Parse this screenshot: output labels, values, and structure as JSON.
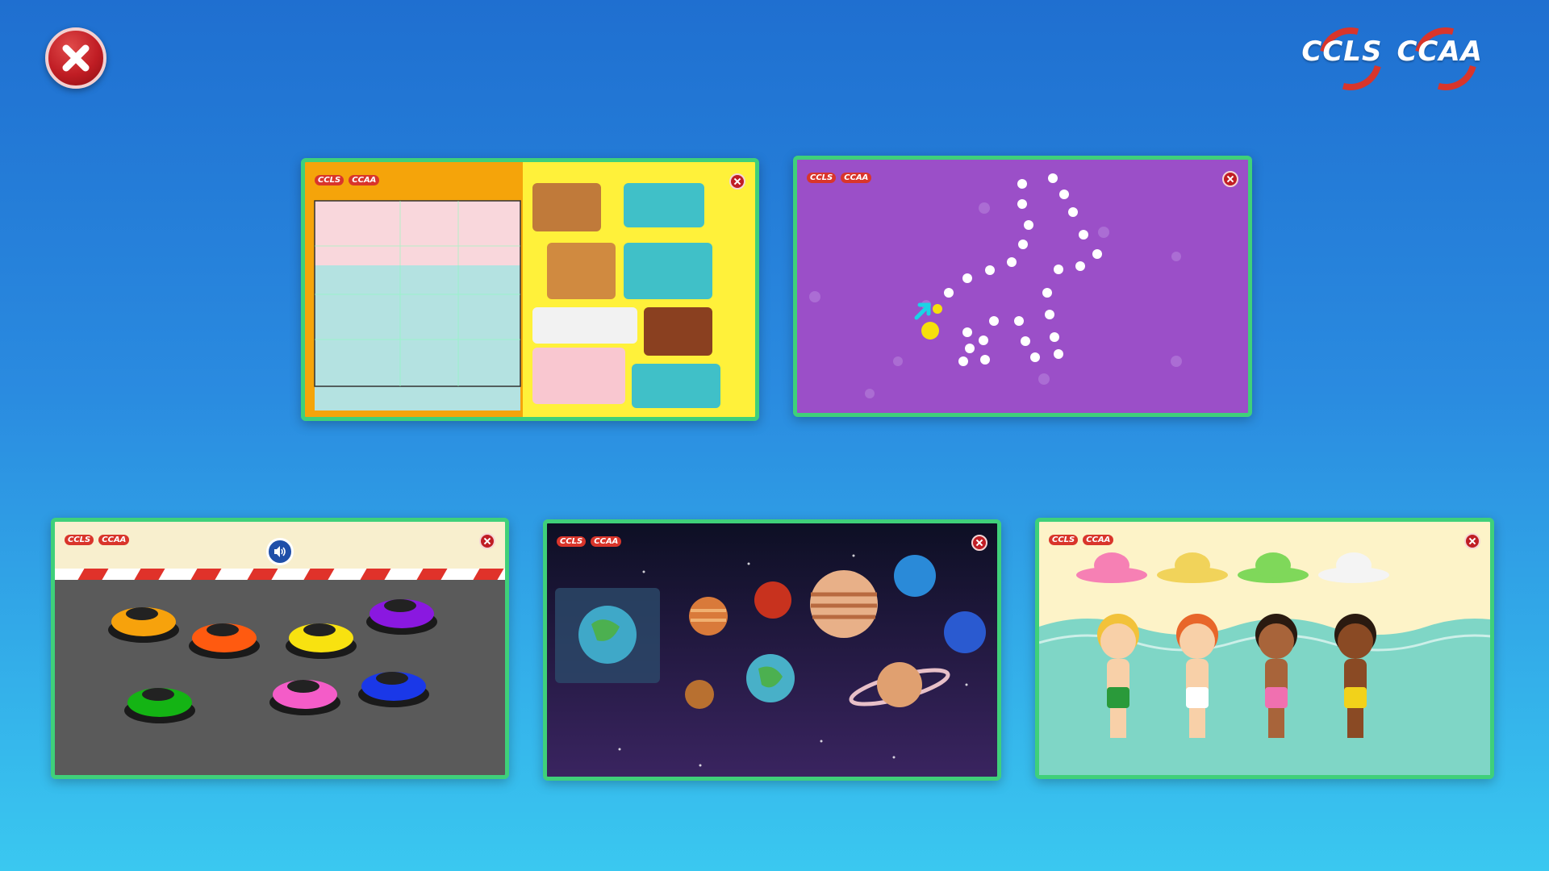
{
  "header": {
    "close_icon": "close-icon",
    "brand": [
      "CCLS",
      "CCAA"
    ]
  },
  "mini_brand": [
    "CCLS",
    "CCAA"
  ],
  "colors": {
    "card_border": "#3fd07a",
    "puzzle_left": "#f5a40a",
    "puzzle_right": "#fff13a",
    "dots_bg": "#9b4fc8",
    "race_track": "#5a5a5a",
    "space_bg": "#1a1a3a",
    "beach_sand": "#fdf3c8",
    "beach_sea": "#7fd6c6"
  },
  "games": [
    {
      "id": "jigsaw-puzzle",
      "theme": "pancakes"
    },
    {
      "id": "connect-the-dots",
      "theme": "shoe"
    },
    {
      "id": "bumper-cars",
      "sound_icon": "speaker-icon",
      "car_colors": [
        "#f7a20c",
        "#ff5a10",
        "#f8e210",
        "#8a18e0",
        "#14b414",
        "#f45cc8",
        "#1a38e8"
      ]
    },
    {
      "id": "planets",
      "planets": [
        "earth",
        "venus",
        "mars",
        "jupiter",
        "neptune",
        "uranus",
        "mercury",
        "saturn"
      ]
    },
    {
      "id": "beach-hats",
      "hat_colors": [
        "#f680b4",
        "#f1d35a",
        "#7fd85a",
        "#f4f4f4"
      ]
    }
  ]
}
